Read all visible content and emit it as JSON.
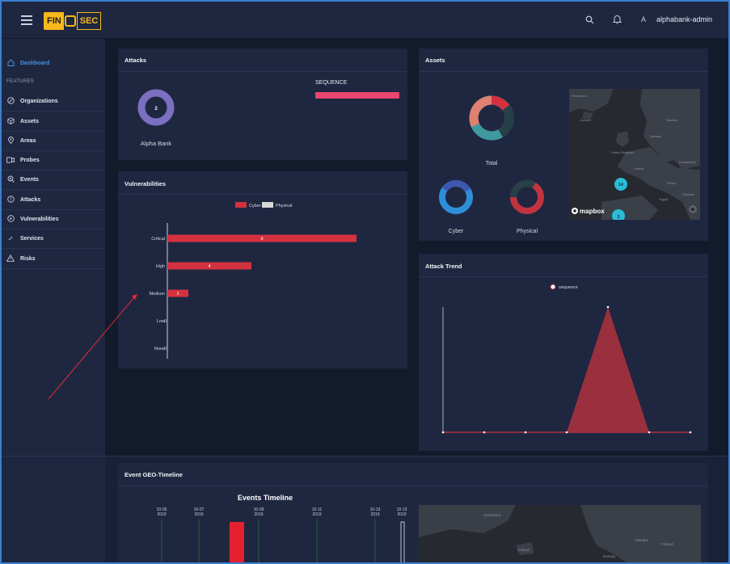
{
  "topbar": {
    "logo_left": "FIN",
    "logo_right": "SEC",
    "user_initial": "A",
    "user_name": "alphabank-admin"
  },
  "sidebar": {
    "dashboard": "Dashboard",
    "section": "FEATURES",
    "items": [
      {
        "label": "Organizations",
        "icon": "organizations-icon"
      },
      {
        "label": "Assets",
        "icon": "assets-icon"
      },
      {
        "label": "Areas",
        "icon": "areas-icon"
      },
      {
        "label": "Probes",
        "icon": "probes-icon"
      },
      {
        "label": "Events",
        "icon": "events-icon"
      },
      {
        "label": "Attacks",
        "icon": "attacks-icon"
      },
      {
        "label": "Vulnerabilities",
        "icon": "vulnerabilities-icon"
      },
      {
        "label": "Services",
        "icon": "services-icon"
      },
      {
        "label": "Risks",
        "icon": "risks-icon"
      }
    ]
  },
  "attacks": {
    "title": "Attacks",
    "donut_value": "2",
    "org_label": "Alpha Bank",
    "sequence_label": "SEQUENCE",
    "donut_color": "#7b6fc0",
    "sequence_color": "#e84670"
  },
  "vulnerabilities": {
    "title": "Vulnerabilities",
    "legend": [
      "Cyber",
      "Physical"
    ],
    "colors": {
      "cyber": "#d4313f",
      "physical": "#d7d7d7"
    }
  },
  "assets": {
    "title": "Assets",
    "total_label": "Total",
    "cyber_label": "Cyber",
    "physical_label": "Physical",
    "map_brand": "mapbox",
    "map_place_label": "Greenland",
    "map_countries": [
      "Iceland",
      "Sweden",
      "Norway",
      "United Kingdom",
      "France",
      "Spain",
      "Turkey",
      "Egypt",
      "Kazakhstan",
      "Pakistan"
    ],
    "clusters": [
      "14",
      "3"
    ],
    "cluster_color": "#29bcd6"
  },
  "attack_trend": {
    "title": "Attack Trend",
    "legend": "sequence",
    "series_color": "#b0313e"
  },
  "geo_timeline": {
    "title": "Event GEO-Timeline",
    "chart_title": "Events Timeline",
    "ticks": [
      {
        "date": "10-05",
        "year": "2019"
      },
      {
        "date": "10-07",
        "year": "2019"
      },
      {
        "date": "10-09",
        "year": "2019"
      },
      {
        "date": "10-11",
        "year": "2019"
      },
      {
        "date": "10-13",
        "year": "2019"
      },
      {
        "date": "10-13",
        "year": "2019"
      }
    ],
    "map_labels": [
      "Greenland",
      "Iceland",
      "Sweden",
      "Norway",
      "Finland"
    ]
  },
  "chart_data": [
    {
      "type": "bar",
      "title": "",
      "categories": [
        "Critical",
        "High",
        "Medium",
        "Low",
        "None"
      ],
      "series": [
        {
          "name": "Cyber",
          "values": [
            9,
            4,
            1,
            0,
            0
          ]
        },
        {
          "name": "Physical",
          "values": [
            0,
            0,
            0,
            0,
            0
          ]
        }
      ],
      "orientation": "horizontal",
      "xlim": [
        0,
        10
      ]
    },
    {
      "type": "area",
      "series": [
        {
          "name": "sequence",
          "values": [
            0,
            0,
            0,
            0,
            1,
            0,
            0
          ]
        }
      ],
      "ylim": [
        0,
        1
      ]
    },
    {
      "type": "pie",
      "title": "Total",
      "note": "donut",
      "colors": [
        "#d4313f",
        "#274048",
        "#3e9aa0",
        "#e08070"
      ]
    }
  ]
}
